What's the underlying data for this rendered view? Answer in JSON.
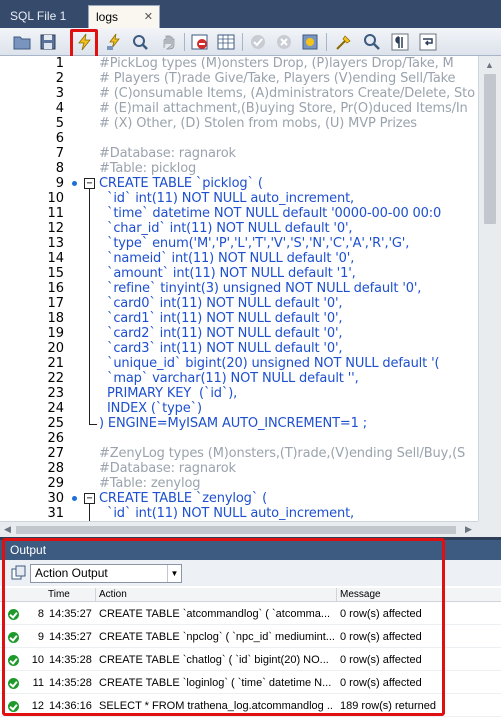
{
  "tabs": [
    {
      "label": "SQL File 1",
      "active": false
    },
    {
      "label": "logs",
      "active": true,
      "close": "✕"
    }
  ],
  "toolbar": {
    "buttons": [
      {
        "name": "open-folder-icon"
      },
      {
        "name": "save-icon"
      },
      {
        "name": "execute-query-icon",
        "highlighted": true
      },
      {
        "name": "execute-current-icon"
      },
      {
        "name": "explain-icon"
      },
      {
        "name": "stop-icon"
      },
      {
        "name": "toggle-output-icon"
      },
      {
        "name": "grid-icon"
      },
      {
        "name": "commit-icon"
      },
      {
        "name": "rollback-icon"
      },
      {
        "name": "autocommit-icon"
      },
      {
        "name": "beautify-icon"
      },
      {
        "name": "find-icon"
      },
      {
        "name": "invisible-chars-icon"
      },
      {
        "name": "wrap-icon"
      }
    ]
  },
  "editor": {
    "lines": [
      {
        "n": "1",
        "text": "#PickLog types (M)onsters Drop, (P)layers Drop/Take, M",
        "kind": "cmt"
      },
      {
        "n": "2",
        "text": "# Players (T)rade Give/Take, Players (V)ending Sell/Take",
        "kind": "cmt"
      },
      {
        "n": "3",
        "text": "# (C)onsumable Items, (A)dministrators Create/Delete, Sto",
        "kind": "cmt"
      },
      {
        "n": "4",
        "text": "# (E)mail attachment,(B)uying Store, Pr(O)duced Items/In",
        "kind": "cmt"
      },
      {
        "n": "5",
        "text": "# (X) Other, (D) Stolen from mobs, (U) MVP Prizes",
        "kind": "cmt"
      },
      {
        "n": "6",
        "text": "",
        "kind": "cmt"
      },
      {
        "n": "7",
        "text": "#Database: ragnarok",
        "kind": "cmt"
      },
      {
        "n": "8",
        "text": "#Table: picklog",
        "kind": "cmt"
      },
      {
        "n": "9",
        "text": "CREATE TABLE `picklog` (",
        "kind": "kw",
        "fold": "start"
      },
      {
        "n": "10",
        "text": "  `id` int(11) NOT NULL auto_increment,",
        "kind": "kw"
      },
      {
        "n": "11",
        "text": "  `time` datetime NOT NULL default '0000-00-00 00:0",
        "kind": "kw"
      },
      {
        "n": "12",
        "text": "  `char_id` int(11) NOT NULL default '0',",
        "kind": "kw"
      },
      {
        "n": "13",
        "text": "  `type` enum('M','P','L','T','V','S','N','C','A','R','G',",
        "kind": "kw"
      },
      {
        "n": "14",
        "text": "  `nameid` int(11) NOT NULL default '0',",
        "kind": "kw"
      },
      {
        "n": "15",
        "text": "  `amount` int(11) NOT NULL default '1',",
        "kind": "kw"
      },
      {
        "n": "16",
        "text": "  `refine` tinyint(3) unsigned NOT NULL default '0',",
        "kind": "kw"
      },
      {
        "n": "17",
        "text": "  `card0` int(11) NOT NULL default '0',",
        "kind": "kw"
      },
      {
        "n": "18",
        "text": "  `card1` int(11) NOT NULL default '0',",
        "kind": "kw"
      },
      {
        "n": "19",
        "text": "  `card2` int(11) NOT NULL default '0',",
        "kind": "kw"
      },
      {
        "n": "20",
        "text": "  `card3` int(11) NOT NULL default '0',",
        "kind": "kw"
      },
      {
        "n": "21",
        "text": "  `unique_id` bigint(20) unsigned NOT NULL default '(",
        "kind": "kw"
      },
      {
        "n": "22",
        "text": "  `map` varchar(11) NOT NULL default '',",
        "kind": "kw"
      },
      {
        "n": "23",
        "text": "  PRIMARY KEY  (`id`),",
        "kind": "kw"
      },
      {
        "n": "24",
        "text": "  INDEX (`type`)",
        "kind": "kw"
      },
      {
        "n": "25",
        "text": ") ENGINE=MyISAM AUTO_INCREMENT=1 ;",
        "kind": "kw",
        "fold": "end"
      },
      {
        "n": "26",
        "text": "",
        "kind": "cmt"
      },
      {
        "n": "27",
        "text": "#ZenyLog types (M)onsters,(T)rade,(V)ending Sell/Buy,(S",
        "kind": "cmt"
      },
      {
        "n": "28",
        "text": "#Database: ragnarok",
        "kind": "cmt"
      },
      {
        "n": "29",
        "text": "#Table: zenylog",
        "kind": "cmt"
      },
      {
        "n": "30",
        "text": "CREATE TABLE `zenylog` (",
        "kind": "kw",
        "fold": "start"
      },
      {
        "n": "31",
        "text": "  `id` int(11) NOT NULL auto_increment,",
        "kind": "kw"
      }
    ]
  },
  "output": {
    "title": "Output",
    "selector": "Action Output",
    "columns": [
      "",
      "Time",
      "Action",
      "Message"
    ],
    "rows": [
      {
        "num": "8",
        "time": "14:35:27",
        "action": "CREATE TABLE `atcommandlog` (   `atcomma...",
        "message": "0 row(s) affected"
      },
      {
        "num": "9",
        "time": "14:35:27",
        "action": "CREATE TABLE `npclog` (   `npc_id` mediumint...",
        "message": "0 row(s) affected"
      },
      {
        "num": "10",
        "time": "14:35:28",
        "action": "CREATE TABLE `chatlog` (   `id` bigint(20) NO...",
        "message": "0 row(s) affected"
      },
      {
        "num": "11",
        "time": "14:35:28",
        "action": "CREATE TABLE `loginlog` (   `time` datetime N...",
        "message": "0 row(s) affected"
      },
      {
        "num": "12",
        "time": "14:36:16",
        "action": "SELECT * FROM trathena_log.atcommandlog ...",
        "message": "189 row(s) returned"
      }
    ]
  },
  "colors": {
    "accent_highlight": "#e01010",
    "keyword": "#1d4fcf",
    "comment": "#9aa3ad",
    "success": "#1e9a2a"
  }
}
